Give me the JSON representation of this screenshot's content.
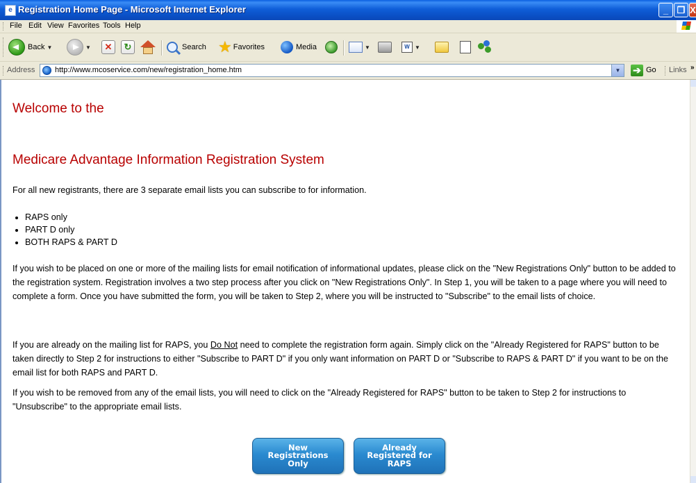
{
  "window": {
    "title": "Registration Home Page - Microsoft Internet Explorer",
    "min_glyph": "_",
    "max_glyph": "❐",
    "close_glyph": "X"
  },
  "menu": [
    "File",
    "Edit",
    "View",
    "Favorites",
    "Tools",
    "Help"
  ],
  "toolbar": {
    "back": "Back",
    "search": "Search",
    "favorites": "Favorites",
    "media": "Media"
  },
  "address": {
    "label": "Address",
    "url": "http://www.mcoservice.com/new/registration_home.htm",
    "go": "Go",
    "links": "Links"
  },
  "page": {
    "heading1": "Welcome to the",
    "heading2": "Medicare Advantage Information Registration System",
    "intro": "For all new registrants, there are 3 separate email lists you can subscribe to for information.",
    "lists": [
      "RAPS only",
      "PART D only",
      "BOTH RAPS & PART D"
    ],
    "para1": "If you wish to be placed on one or more of the mailing lists for email notification of informational updates, please click on the \"New Registrations Only\" button to be added to the registration system. Registration involves a two step process after you click on \"New Registrations Only\". In Step 1, you will be taken to a page where you will need to complete a form. Once you have submitted the form, you will be taken to Step 2, where you will be instructed to \"Subscribe\" to the email lists of choice.",
    "para2_before": "If you are already on the mailing list for RAPS, you ",
    "para2_underline": "Do Not",
    "para2_after": " need to complete the registration form again. Simply click on the \"Already Registered for RAPS\" button to be taken directly to Step 2 for instructions to either \"Subscribe to PART D\" if you only want information on PART D or \"Subscribe to RAPS & PART D\" if you want to be on the email list for both RAPS and PART D.",
    "para3": "If you wish to be removed from any of the email lists, you will need to click on the \"Already Registered for RAPS\" button to be taken to Step 2 for instructions to \"Unsubscribe\" to the appropriate email lists.",
    "btn_new": "New Registrations Only",
    "btn_already": "Already Registered for RAPS"
  }
}
